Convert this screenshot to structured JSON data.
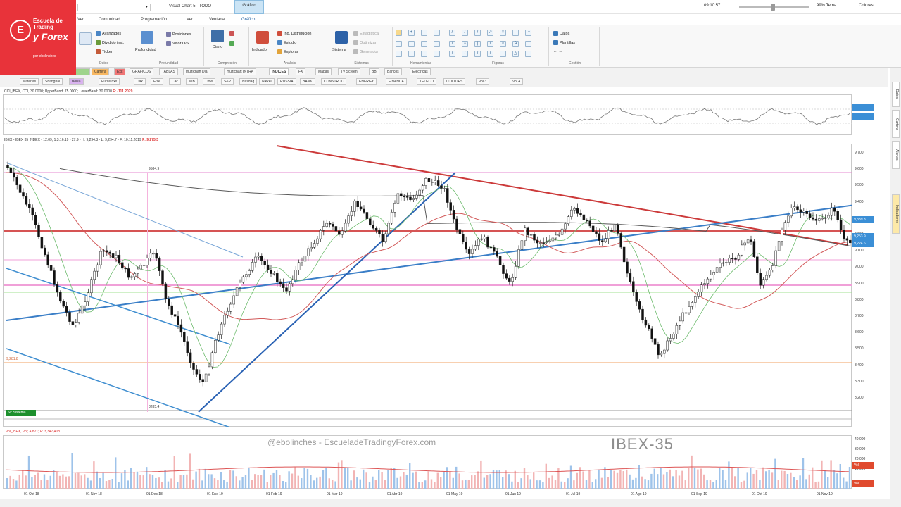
{
  "logo": {
    "mark": "E",
    "line1": "Escuela de",
    "line2": "Trading",
    "line3": "y Forex",
    "line4": "",
    "line5": "por ebolinches"
  },
  "titlebar": {
    "combo_value": "",
    "window_title": "Visual Chart 5 - TODO",
    "context_tab": "Gráfico",
    "clock": "09:10:57",
    "zoom": "99%",
    "zoom_unit": "Tema",
    "theme": "Colores"
  },
  "menu": {
    "items": [
      "Ver",
      "Comunidad",
      "Programación",
      "Ver",
      "Ventana",
      "Gráfico"
    ]
  },
  "ribbon": {
    "groups": [
      "Datos",
      "Profundidad",
      "Compresión",
      "Análisis",
      "Sistemas",
      "Herramientas",
      "Figuras",
      "Gestión"
    ],
    "datos": [
      "Avanzados",
      "Dividido inst.",
      "Ticker"
    ],
    "profundidad": [
      "Profundidad",
      "Posiciones",
      "Visor O/S"
    ],
    "compresion": [
      "Diario",
      "Días"
    ],
    "analisis": [
      "Indicador",
      "Ind. Distribución",
      "Estudio",
      "Explorar"
    ],
    "sistemas": [
      "Sistema",
      "Estadística",
      "Optimizar",
      "Generador"
    ],
    "gestion": [
      "Datos",
      "Plantillas"
    ]
  },
  "tabs_row1": [
    "Cartera",
    "Exit",
    "GRAFICOS",
    "TABLAS",
    "multichart Dia",
    "multichart INTRA",
    "INDICES",
    "FX",
    "Mapas",
    "TV Screen",
    "BB",
    "Bancos",
    "Eléctricas"
  ],
  "tabs_row2": [
    "Materias",
    "Shanghai",
    "Bolsa",
    "Eurostoxx",
    "Dax",
    "Ftse",
    "Cac",
    "MIB",
    "Dow",
    "S&P",
    "Nasdaq",
    "Nikkei",
    "RUSSIA",
    "BANK",
    "CONSTRUC",
    "ENERGY",
    "FINANCE",
    "TELECO",
    "UTILITIES",
    "Vol 3",
    "Vol 4"
  ],
  "indicator": {
    "header": "CCI_IBEX, CCI, 30.0000; UpperBand: 75.0000; LowerBand: 30.0000",
    "value": "F: -111.2029"
  },
  "price": {
    "header": "IBEX - IBEX 35 INDEX - 12.09, 1.3.16.19 - 27.9 - H: 9,294.3 - L: 9,294.7 - F: 10.11.2019",
    "value": "F: 9,275.3",
    "label_high": "9584.9",
    "label_low": "8285.4",
    "label_level": "9,281.8",
    "signal_box": "St: Sistema"
  },
  "yaxis": {
    "ticks": [
      "9,700",
      "9,600",
      "9,500",
      "9,400",
      "9,300",
      "9,200",
      "9,100",
      "9,000",
      "8,900",
      "8,800",
      "8,700",
      "8,600",
      "8,500",
      "8,400",
      "8,300",
      "8,200"
    ],
    "badge_blue1": "9,339.3",
    "badge_blue2": "9,253.9",
    "badge_blue3": "9,224.6"
  },
  "volume": {
    "header": "Vol_IBEX, Vol; 4,821; F: 3,347,408",
    "ticks": [
      "40,000",
      "30,000",
      "20,000",
      "10,000"
    ],
    "badge1": "Vol",
    "badge2": "Vol"
  },
  "watermark": "@ebolinches - EscueladeTradingyForex.com",
  "symbol_watermark": "IBEX-35",
  "xaxis": [
    "01 Oct 18",
    "01 Nov 18",
    "01 Dec 18",
    "01 Ene 19",
    "01 Feb 19",
    "01 Mar 19",
    "01 Abr 19",
    "01 May 19",
    "01 Jun 19",
    "01 Jul 19",
    "01 Ago 19",
    "01 Sep 19",
    "01 Oct 19",
    "01 Nov 19"
  ],
  "right_side": [
    "Datos",
    "Cartera",
    "Alertas",
    "Indicadores"
  ]
}
